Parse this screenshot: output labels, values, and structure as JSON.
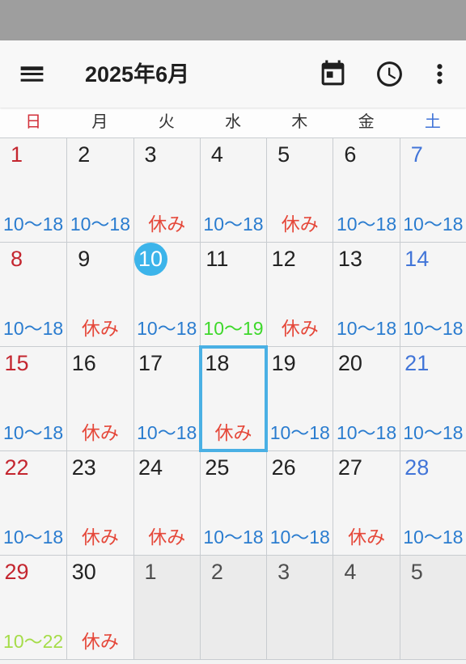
{
  "app_bar": {
    "title": "2025年6月",
    "icons": {
      "menu": "menu-icon",
      "today": "today-icon",
      "clock": "clock-icon",
      "more": "more-vert-icon"
    }
  },
  "weekdays": [
    {
      "label": "日",
      "color": "#d2303a"
    },
    {
      "label": "月",
      "color": "#333333"
    },
    {
      "label": "火",
      "color": "#333333"
    },
    {
      "label": "水",
      "color": "#333333"
    },
    {
      "label": "木",
      "color": "#333333"
    },
    {
      "label": "金",
      "color": "#333333"
    },
    {
      "label": "土",
      "color": "#3f72d8"
    }
  ],
  "calendar": {
    "weeks": [
      [
        {
          "day": "1",
          "label": "10〜18",
          "label_color": "#2a7ccf"
        },
        {
          "day": "2",
          "label": "10〜18",
          "label_color": "#2a7ccf"
        },
        {
          "day": "3",
          "label": "休み",
          "label_color": "#e5483a"
        },
        {
          "day": "4",
          "label": "10〜18",
          "label_color": "#2a7ccf"
        },
        {
          "day": "5",
          "label": "休み",
          "label_color": "#e5483a"
        },
        {
          "day": "6",
          "label": "10〜18",
          "label_color": "#2a7ccf"
        },
        {
          "day": "7",
          "label": "10〜18",
          "label_color": "#2a7ccf"
        }
      ],
      [
        {
          "day": "8",
          "label": "10〜18",
          "label_color": "#2a7ccf"
        },
        {
          "day": "9",
          "label": "休み",
          "label_color": "#e5483a"
        },
        {
          "day": "10",
          "label": "10〜18",
          "label_color": "#2a7ccf",
          "today": true
        },
        {
          "day": "11",
          "label": "10〜19",
          "label_color": "#3ed82b"
        },
        {
          "day": "12",
          "label": "休み",
          "label_color": "#e5483a"
        },
        {
          "day": "13",
          "label": "10〜18",
          "label_color": "#2a7ccf"
        },
        {
          "day": "14",
          "label": "10〜18",
          "label_color": "#2a7ccf"
        }
      ],
      [
        {
          "day": "15",
          "label": "10〜18",
          "label_color": "#2a7ccf"
        },
        {
          "day": "16",
          "label": "休み",
          "label_color": "#e5483a"
        },
        {
          "day": "17",
          "label": "10〜18",
          "label_color": "#2a7ccf"
        },
        {
          "day": "18",
          "label": "休み",
          "label_color": "#e5483a",
          "selected": true
        },
        {
          "day": "19",
          "label": "10〜18",
          "label_color": "#2a7ccf"
        },
        {
          "day": "20",
          "label": "10〜18",
          "label_color": "#2a7ccf"
        },
        {
          "day": "21",
          "label": "10〜18",
          "label_color": "#2a7ccf"
        }
      ],
      [
        {
          "day": "22",
          "label": "10〜18",
          "label_color": "#2a7ccf"
        },
        {
          "day": "23",
          "label": "休み",
          "label_color": "#e5483a"
        },
        {
          "day": "24",
          "label": "休み",
          "label_color": "#e5483a"
        },
        {
          "day": "25",
          "label": "10〜18",
          "label_color": "#2a7ccf"
        },
        {
          "day": "26",
          "label": "10〜18",
          "label_color": "#2a7ccf"
        },
        {
          "day": "27",
          "label": "休み",
          "label_color": "#e5483a"
        },
        {
          "day": "28",
          "label": "10〜18",
          "label_color": "#2a7ccf"
        }
      ],
      [
        {
          "day": "29",
          "label": "10〜22",
          "label_color": "#a5dc48"
        },
        {
          "day": "30",
          "label": "休み",
          "label_color": "#e5483a"
        },
        {
          "day": "1",
          "other_month": true
        },
        {
          "day": "2",
          "other_month": true
        },
        {
          "day": "3",
          "other_month": true
        },
        {
          "day": "4",
          "other_month": true
        },
        {
          "day": "5",
          "other_month": true
        }
      ]
    ]
  },
  "colors": {
    "status_bar": "#9e9e9e",
    "sunday_day": "#c4262f",
    "saturday_day": "#4275d8",
    "weekday_day": "#222222",
    "other_month_day": "#4f4f4f",
    "today_circle": "#3cb4ea",
    "today_text": "#ffffff",
    "selected_border": "#4ab0e4"
  }
}
